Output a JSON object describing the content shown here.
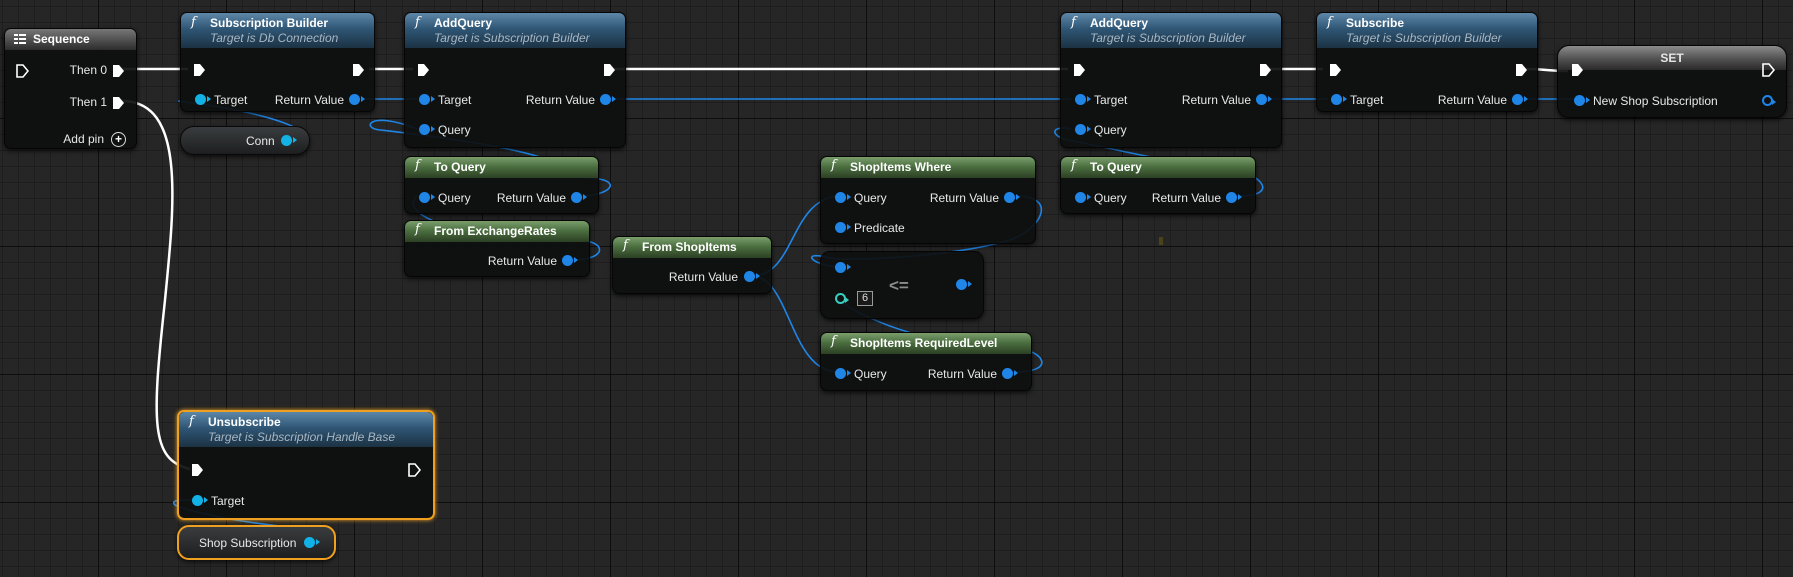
{
  "nodes": {
    "sequence": {
      "title": "Sequence",
      "pins": {
        "then0": "Then 0",
        "then1": "Then 1",
        "add_pin": "Add pin"
      }
    },
    "subscription_builder": {
      "title": "Subscription Builder",
      "subtitle": "Target is Db Connection",
      "pins": {
        "target": "Target",
        "return_value": "Return Value"
      }
    },
    "conn_var": {
      "label": "Conn"
    },
    "add_query_1": {
      "title": "AddQuery",
      "subtitle": "Target is Subscription Builder",
      "pins": {
        "target": "Target",
        "query": "Query",
        "return_value": "Return Value"
      }
    },
    "to_query_1": {
      "title": "To Query",
      "pins": {
        "query": "Query",
        "return_value": "Return Value"
      }
    },
    "from_exchange_rates": {
      "title": "From ExchangeRates",
      "pins": {
        "return_value": "Return Value"
      }
    },
    "from_shop_items": {
      "title": "From ShopItems",
      "pins": {
        "return_value": "Return Value"
      }
    },
    "shop_items_where": {
      "title": "ShopItems Where",
      "pins": {
        "query": "Query",
        "predicate": "Predicate",
        "return_value": "Return Value"
      }
    },
    "compare": {
      "operator": "<=",
      "literal": "6"
    },
    "shop_items_required_level": {
      "title": "ShopItems RequiredLevel",
      "pins": {
        "query": "Query",
        "return_value": "Return Value"
      }
    },
    "add_query_2": {
      "title": "AddQuery",
      "subtitle": "Target is Subscription Builder",
      "pins": {
        "target": "Target",
        "query": "Query",
        "return_value": "Return Value"
      }
    },
    "to_query_2": {
      "title": "To Query",
      "pins": {
        "query": "Query",
        "return_value": "Return Value"
      }
    },
    "subscribe": {
      "title": "Subscribe",
      "subtitle": "Target is Subscription Builder",
      "pins": {
        "target": "Target",
        "return_value": "Return Value"
      }
    },
    "set": {
      "title": "SET",
      "pins": {
        "new_shop_subscription": "New Shop Subscription"
      }
    },
    "unsubscribe": {
      "title": "Unsubscribe",
      "subtitle": "Target is Subscription Handle Base",
      "pins": {
        "target": "Target"
      }
    },
    "shop_subscription_var": {
      "label": "Shop Subscription"
    }
  },
  "colors": {
    "background": "#262626",
    "exec_wire": "#ffffff",
    "object_wire": "#1f86e8",
    "selection": "#f0a020",
    "function_header": "#2f5675",
    "pure_header": "#486b3d"
  },
  "icons": {
    "function": "f-function-icon",
    "sequence": "sequence-icon",
    "exec": "exec-arrow-icon",
    "add": "plus-circle-icon"
  }
}
